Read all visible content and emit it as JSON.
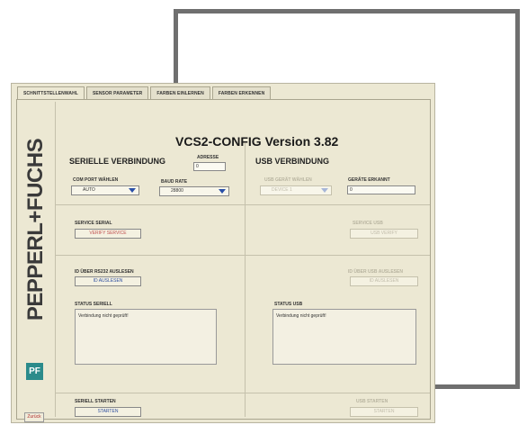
{
  "tabs": [
    "SCHNITTSTELLENWAHL",
    "SENSOR PARAMETER",
    "FARBEN EINLERNEN",
    "FARBEN ERKENNEN"
  ],
  "brand": "PEPPERL+FUCHS",
  "brand_logo": "ꟼ",
  "back_button": "Zurück",
  "title": "VCS2-CONFIG Version 3.82",
  "serial": {
    "heading": "SERIELLE VERBINDUNG",
    "address_label": "ADRESSE",
    "address_value": "0",
    "com_port_label": "COM PORT WÄHLEN",
    "com_port_value": "AUTO",
    "baud_label": "BAUD RATE",
    "baud_value": "28800",
    "service_label": "SERVICE SERIAL",
    "service_button": "VERIFY SERVICE",
    "read_id_label": "ID ÜBER RS232 AUSLESEN",
    "read_id_button": "ID AUSLESEN",
    "status_label": "STATUS SERIELL",
    "status_text": "Verbindung nicht geprüft!",
    "start_label": "SERIELL STARTEN",
    "start_button": "STARTEN"
  },
  "usb": {
    "heading": "USB VERBINDUNG",
    "device_label": "USB GERÄT WÄHLEN",
    "device_value": "DEVICE 1",
    "detected_label": "GERÄTE ERKANNT",
    "detected_value": "0",
    "service_label": "SERVICE USB",
    "service_button": "USB VERIFY",
    "read_id_label": "ID ÜBER USB AUSLESEN",
    "read_id_button": "ID AUSLESEN",
    "status_label": "STATUS USB",
    "status_text": "Verbindung nicht geprüft!",
    "start_label": "USB STARTEN",
    "start_button": "STARTEN"
  }
}
